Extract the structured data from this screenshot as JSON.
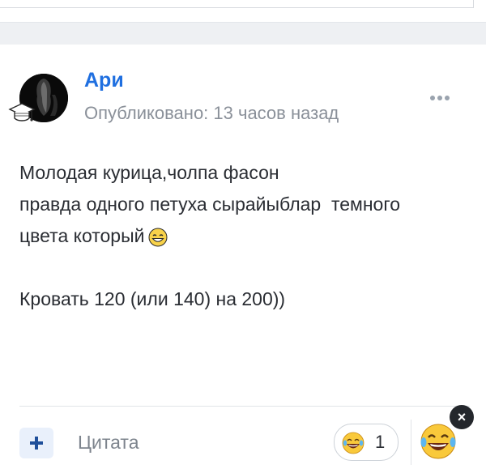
{
  "post": {
    "author": "Ари",
    "meta": "Опубликовано: 13 часов назад",
    "lines": [
      "Молодая курица,чолпа фасон",
      "правда одного петуха сырайыблар  темного",
      "цвета который"
    ],
    "line2": "Кровать 120 (или 140) на 200))"
  },
  "footer": {
    "quote_label": "Цитата",
    "reaction_count": "1",
    "close_label": "×"
  },
  "icons": {
    "more": "more-dots-icon",
    "plus": "plus-icon",
    "reaction": "laughing-emoji-icon",
    "close": "close-icon",
    "hat": "graduation-cap-icon"
  },
  "colors": {
    "author": "#1f6fe0",
    "meta": "#8a9099",
    "accent_bg": "#e9f0fb"
  }
}
